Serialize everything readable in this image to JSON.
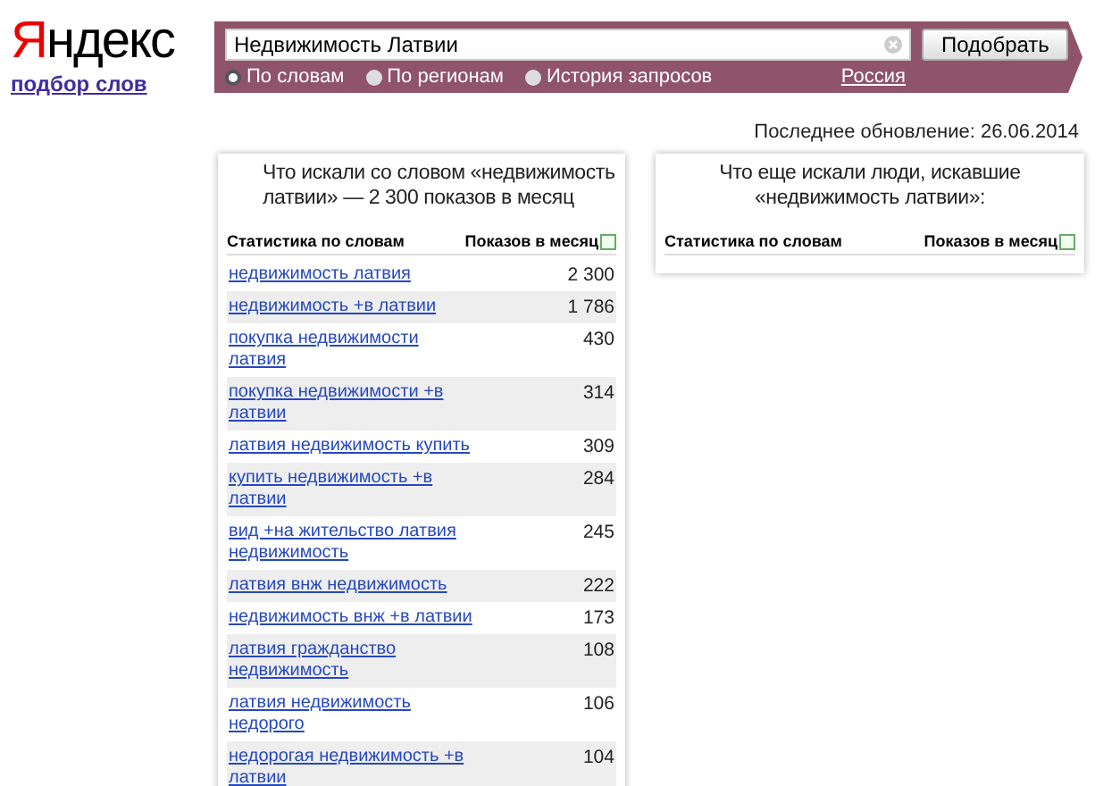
{
  "logo": {
    "title": "Яндекс",
    "subtitle": "подбор слов"
  },
  "search": {
    "value": "Недвижимость Латвии",
    "button": "Подобрать",
    "region": "Россия",
    "modes": [
      {
        "label": "По словам",
        "selected": true
      },
      {
        "label": "По регионам",
        "selected": false
      },
      {
        "label": "История запросов",
        "selected": false
      }
    ]
  },
  "last_update": "Последнее обновление: 26.06.2014",
  "left_panel": {
    "title": "Что искали со словом «недвижимость латвии» — 2 300 показов в месяц",
    "columns": [
      "Статистика по словам",
      "Показов в месяц"
    ],
    "rows": [
      {
        "phrase": "недвижимость латвия",
        "count": "2 300"
      },
      {
        "phrase": "недвижимость +в латвии",
        "count": "1 786"
      },
      {
        "phrase": "покупка недвижимости латвия",
        "count": "430"
      },
      {
        "phrase": "покупка недвижимости +в латвии",
        "count": "314"
      },
      {
        "phrase": "латвия недвижимость купить",
        "count": "309"
      },
      {
        "phrase": "купить недвижимость +в латвии",
        "count": "284"
      },
      {
        "phrase": "вид +на жительство латвия недвижимость",
        "count": "245"
      },
      {
        "phrase": "латвия внж недвижимость",
        "count": "222"
      },
      {
        "phrase": "недвижимость внж +в латвии",
        "count": "173"
      },
      {
        "phrase": "латвия гражданство недвижимость",
        "count": "108"
      },
      {
        "phrase": "латвия недвижимость недорого",
        "count": "106"
      },
      {
        "phrase": "недорогая недвижимость +в латвии",
        "count": "104"
      }
    ]
  },
  "right_panel": {
    "title": "Что еще искали люди, искавшие «недвижимость латвии»:",
    "columns": [
      "Статистика по словам",
      "Показов в месяц"
    ]
  }
}
